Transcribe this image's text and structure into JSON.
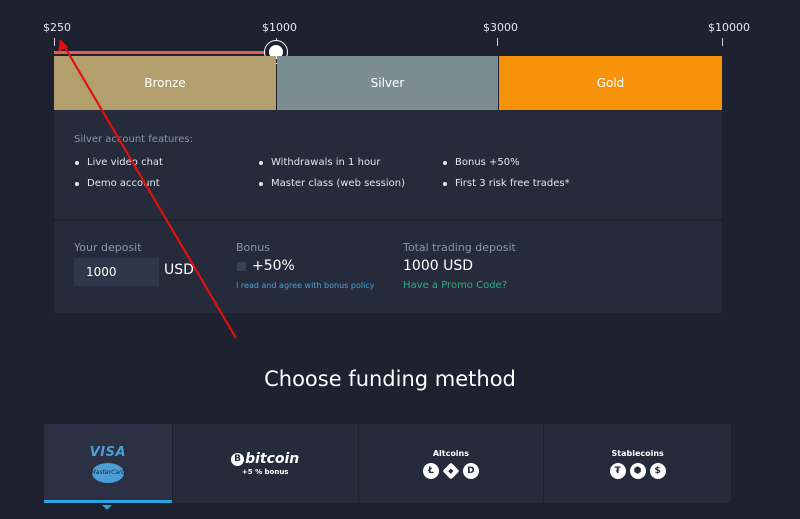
{
  "scale": {
    "ticks": [
      "$250",
      "$1000",
      "$3000",
      "$10000"
    ],
    "selected_tier": "Silver"
  },
  "tiers": [
    "Bronze",
    "Silver",
    "Gold"
  ],
  "features": {
    "title": "Silver account features:",
    "items": [
      "Live video chat",
      "Demo account",
      "Withdrawals in 1 hour",
      "Master class (web session)",
      "Bonus +50%",
      "First 3 risk free trades*"
    ]
  },
  "deposit": {
    "label": "Your deposit",
    "value": "1000",
    "currency": "USD"
  },
  "bonus": {
    "label": "Bonus",
    "value": "+50%",
    "agree_link": "I read and agree with bonus policy"
  },
  "total": {
    "label": "Total trading deposit",
    "value": "1000 USD",
    "promo_link": "Have a Promo Code?"
  },
  "funding": {
    "title": "Choose funding method",
    "methods": {
      "cards": {
        "visa": "VISA",
        "mastercard": "MasterCard"
      },
      "bitcoin": {
        "symbol": "B",
        "name": "bitcoin",
        "bonus": "+5 % bonus"
      },
      "altcoins": {
        "title": "Altcoins",
        "icons": [
          "litecoin-icon",
          "ethereum-icon",
          "dash-icon"
        ],
        "glyphs": [
          "Ł",
          "◆",
          "D"
        ]
      },
      "stablecoins": {
        "title": "Stablecoins",
        "icons": [
          "tether-icon",
          "usdc-icon",
          "dai-icon"
        ],
        "glyphs": [
          "₮",
          "⬢",
          "$"
        ]
      }
    },
    "active": "cards"
  },
  "colors": {
    "background": "#1d2130",
    "panel": "#262b3b",
    "bronze": "#b39e6e",
    "silver": "#7b8d91",
    "gold": "#f7930a",
    "track": "#e0604a",
    "link_blue": "#4a9fd8",
    "link_green": "#2eaf7d",
    "annotation_arrow": "#e01010"
  }
}
